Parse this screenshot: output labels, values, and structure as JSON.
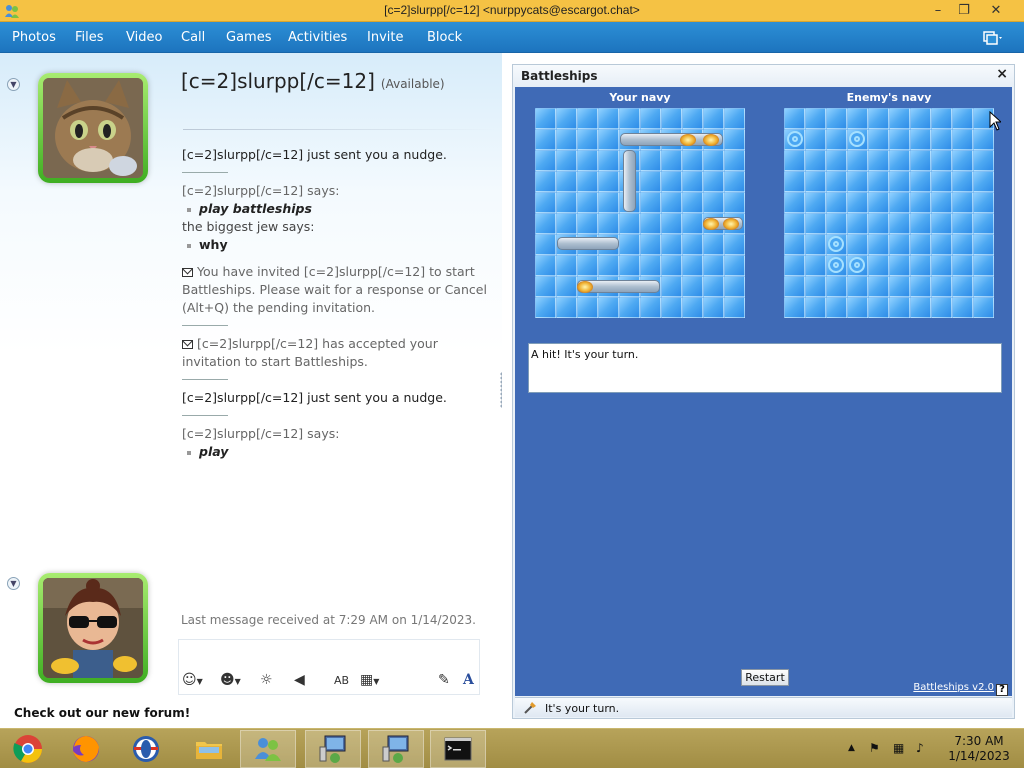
{
  "window": {
    "title": "[c=2]slurpp[/c=12] <nurppycats@escargot.chat>",
    "controls": [
      "minimize",
      "maximize",
      "close"
    ]
  },
  "menu": {
    "items": [
      "Photos",
      "Files",
      "Video",
      "Call",
      "Games",
      "Activities",
      "Invite",
      "Block"
    ]
  },
  "contact": {
    "name": "[c=2]slurpp[/c=12]",
    "status": "(Available)"
  },
  "chat": {
    "nudge1": "[c=2]slurpp[/c=12] just sent you a nudge.",
    "says1": "[c=2]slurpp[/c=12] says:",
    "msg1": "play battleships",
    "says2": "the biggest jew says:",
    "msg2": "why",
    "invite_text": "You have invited [c=2]slurpp[/c=12] to start Battleships. Please wait for a response or Cancel (Alt+Q) the pending invitation.",
    "accepted_text": "[c=2]slurpp[/c=12] has accepted your invitation to start Battleships.",
    "nudge2": "[c=2]slurpp[/c=12] just sent you a nudge.",
    "says3": "[c=2]slurpp[/c=12] says:",
    "msg3": "play"
  },
  "footer": {
    "last_message": "Last message received at 7:29 AM on 1/14/2023.",
    "forum_link": "Check out our new forum!"
  },
  "game": {
    "title": "Battleships",
    "your_navy_label": "Your navy",
    "enemy_navy_label": "Enemy's navy",
    "message": "A hit! It's your turn.",
    "restart_label": "Restart",
    "version_label": "Battleships v2.0",
    "help_label": "?",
    "status": "It's your turn."
  },
  "taskbar": {
    "apps": [
      "chrome-icon",
      "firefox-icon",
      "opera-icon",
      "folder-icon",
      "messenger-icon",
      "network-icon",
      "network-icon",
      "cmd-icon"
    ],
    "time": "7:30 AM",
    "date": "1/14/2023"
  },
  "colors": {
    "titlebar": "#f5c244",
    "menubar": "#2c8fd6",
    "game_bg": "#3f6ab6",
    "taskbar": "#b7a35a",
    "avatar_frame": "#3fae22"
  }
}
